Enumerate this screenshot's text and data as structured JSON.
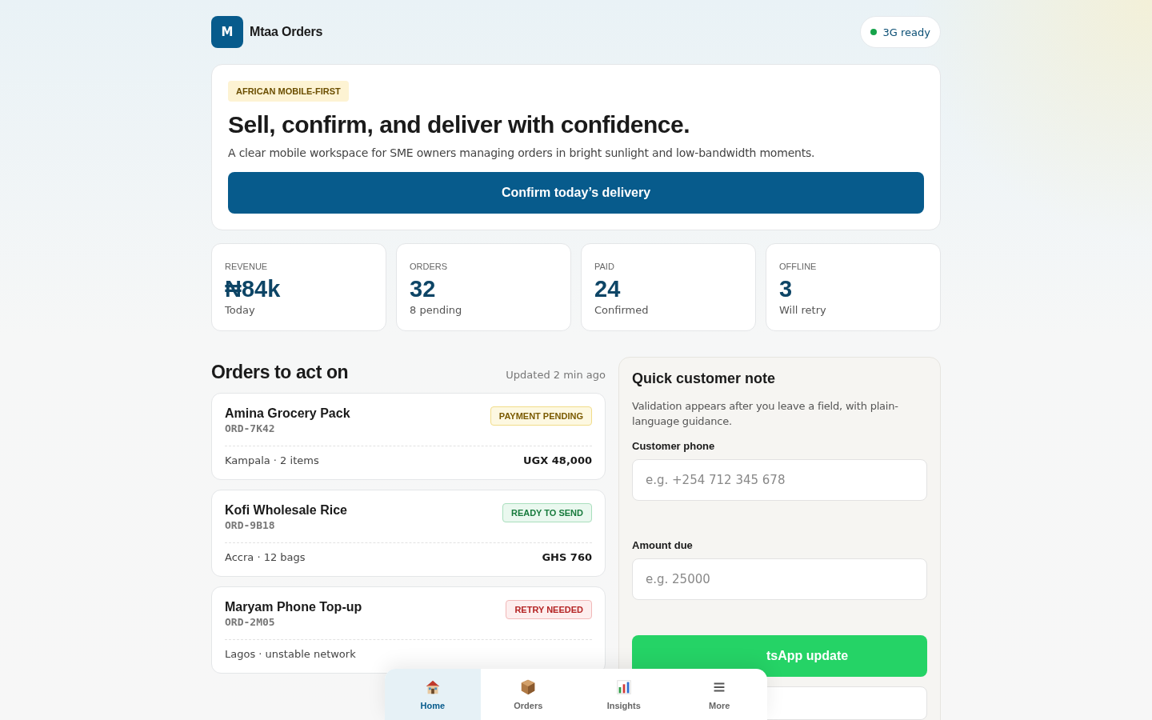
{
  "brand": {
    "logo_letter": "M",
    "name": "Mtaa Orders"
  },
  "network_status": {
    "label": "3G ready",
    "color": "#16a34a"
  },
  "hero": {
    "tag": "AFRICAN MOBILE-FIRST",
    "title": "Sell, confirm, and deliver with confidence.",
    "subtitle": "A clear mobile workspace for SME owners managing orders in bright sunlight and low-bandwidth moments.",
    "button": "Confirm today’s delivery"
  },
  "stats": [
    {
      "label": "REVENUE",
      "value": "₦84k",
      "note": "Today"
    },
    {
      "label": "ORDERS",
      "value": "32",
      "note": "8 pending"
    },
    {
      "label": "PAID",
      "value": "24",
      "note": "Confirmed"
    },
    {
      "label": "OFFLINE",
      "value": "3",
      "note": "Will retry"
    }
  ],
  "orders": {
    "title": "Orders to act on",
    "updated": "Updated 2 min ago",
    "items": [
      {
        "name": "Amina Grocery Pack",
        "id": "ORD-7K42",
        "status": "PAYMENT PENDING",
        "kind": "pending",
        "details": "Kampala · 2 items",
        "amount": "UGX 48,000"
      },
      {
        "name": "Kofi Wholesale Rice",
        "id": "ORD-9B18",
        "status": "READY TO SEND",
        "kind": "ready",
        "details": "Accra · 12 bags",
        "amount": "GHS 760"
      },
      {
        "name": "Maryam Phone Top-up",
        "id": "ORD-2M05",
        "status": "RETRY NEEDED",
        "kind": "retry",
        "details": "Lagos · unstable network"
      }
    ]
  },
  "note_form": {
    "title": "Quick customer note",
    "help": "Validation appears after you leave a field, with plain-language guidance.",
    "fields": [
      {
        "label": "Customer phone",
        "placeholder": "e.g. +254 712 345 678"
      },
      {
        "label": "Amount due",
        "placeholder": "e.g. 25000"
      }
    ],
    "button": "tsApp update"
  },
  "bottom_nav": [
    {
      "label": "Home",
      "kind": "home",
      "selected": true
    },
    {
      "label": "Orders",
      "kind": "orders",
      "selected": false
    },
    {
      "label": "Insights",
      "kind": "insights",
      "selected": false
    },
    {
      "label": "More",
      "kind": "more",
      "selected": false
    }
  ]
}
